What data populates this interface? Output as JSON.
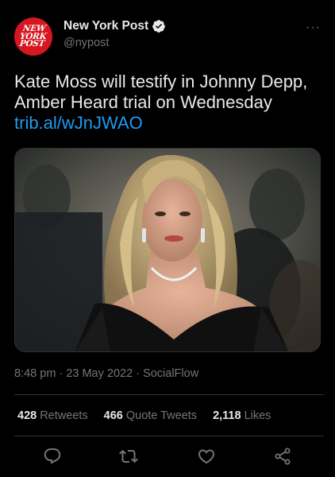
{
  "account": {
    "display_name": "New York Post",
    "handle": "@nypost",
    "avatar_lines": [
      "NEW",
      "YORK",
      "POST"
    ],
    "avatar_color": "#d6171f",
    "verified": true
  },
  "more_label": "···",
  "tweet": {
    "text": "Kate Moss will testify in Johnny Depp, Amber Heard trial on Wednesday",
    "link": "trib.al/wJnJWAO",
    "link_color": "#1d9bf0"
  },
  "meta": {
    "time": "8:48 pm",
    "separator": "·",
    "date": "23 May 2022",
    "source": "SocialFlow"
  },
  "stats": {
    "retweets_count": "428",
    "retweets_label": "Retweets",
    "quote_count": "466",
    "quote_label": "Quote Tweets",
    "likes_count": "2,118",
    "likes_label": "Likes"
  },
  "actions": [
    "reply-icon",
    "retweet-icon",
    "like-icon",
    "share-icon"
  ]
}
